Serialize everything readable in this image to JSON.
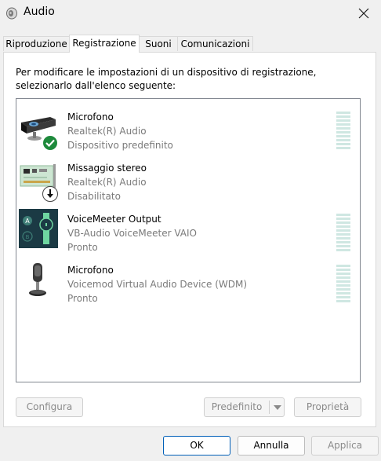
{
  "window": {
    "title": "Audio",
    "close_icon": "close-icon"
  },
  "tabs": [
    {
      "label": "Riproduzione",
      "active": false
    },
    {
      "label": "Registrazione",
      "active": true
    },
    {
      "label": "Suoni",
      "active": false
    },
    {
      "label": "Comunicazioni",
      "active": false
    }
  ],
  "instructions": "Per modificare le impostazioni di un dispositivo di registrazione, selezionarlo dall'elenco seguente:",
  "devices": [
    {
      "name": "Microfono",
      "driver": "Realtek(R) Audio",
      "status": "Dispositivo predefinito",
      "icon": "webcam-microphone-icon",
      "badge": "default-check-icon",
      "level_meter": true
    },
    {
      "name": "Missaggio stereo",
      "driver": "Realtek(R) Audio",
      "status": "Disabilitato",
      "icon": "sound-card-icon",
      "badge": "disabled-arrow-icon",
      "level_meter": false
    },
    {
      "name": "VoiceMeeter Output",
      "driver": "VB-Audio VoiceMeeter VAIO",
      "status": "Pronto",
      "icon": "voicemeeter-icon",
      "badge": "",
      "level_meter": true
    },
    {
      "name": "Microfono",
      "driver": "Voicemod Virtual Audio Device (WDM)",
      "status": "Pronto",
      "icon": "desktop-microphone-icon",
      "badge": "",
      "level_meter": true
    }
  ],
  "buttons": {
    "configure": "Configura",
    "set_default": "Predefinito",
    "properties": "Proprietà",
    "ok": "OK",
    "cancel": "Annulla",
    "apply": "Applica"
  },
  "colors": {
    "meter": "#cfe7e2",
    "check": "#1e8a3c",
    "accent": "#005fb8",
    "disabled_text": "#8a8a8a",
    "secondary_text": "#7a7a7a"
  }
}
